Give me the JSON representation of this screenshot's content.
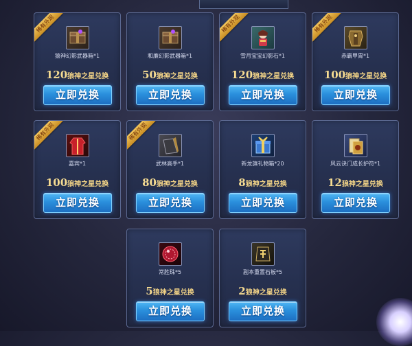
{
  "ribbon_label": "稀有外观",
  "currency_suffix": "狼神之星兑换",
  "button_label": "立即兑换",
  "cards": [
    {
      "name": "猿神幻影武器箱*1",
      "price": "120",
      "rare": true,
      "icon": "weapon-box-icon"
    },
    {
      "name": "和廉幻影武器箱*1",
      "price": "50",
      "rare": false,
      "icon": "weapon-box-icon"
    },
    {
      "name": "雪月宝宝幻影石*1",
      "price": "120",
      "rare": true,
      "icon": "doll-icon"
    },
    {
      "name": "赤霸甲胄*1",
      "price": "100",
      "rare": true,
      "icon": "armor-icon"
    },
    {
      "name": "嘉宾*1",
      "price": "100",
      "rare": true,
      "icon": "red-coat-icon"
    },
    {
      "name": "武林高手*1",
      "price": "80",
      "rare": true,
      "icon": "glove-icon"
    },
    {
      "name": "新龙旗礼物箱*20",
      "price": "8",
      "rare": false,
      "icon": "gift-box-icon"
    },
    {
      "name": "风云诀门成长护符*1",
      "price": "12",
      "rare": false,
      "icon": "talisman-icon"
    },
    {
      "name": "常胜珠*5",
      "price": "5",
      "rare": false,
      "icon": "orb-icon"
    },
    {
      "name": "副本重置石板*5",
      "price": "2",
      "rare": false,
      "icon": "stone-tablet-icon"
    }
  ]
}
